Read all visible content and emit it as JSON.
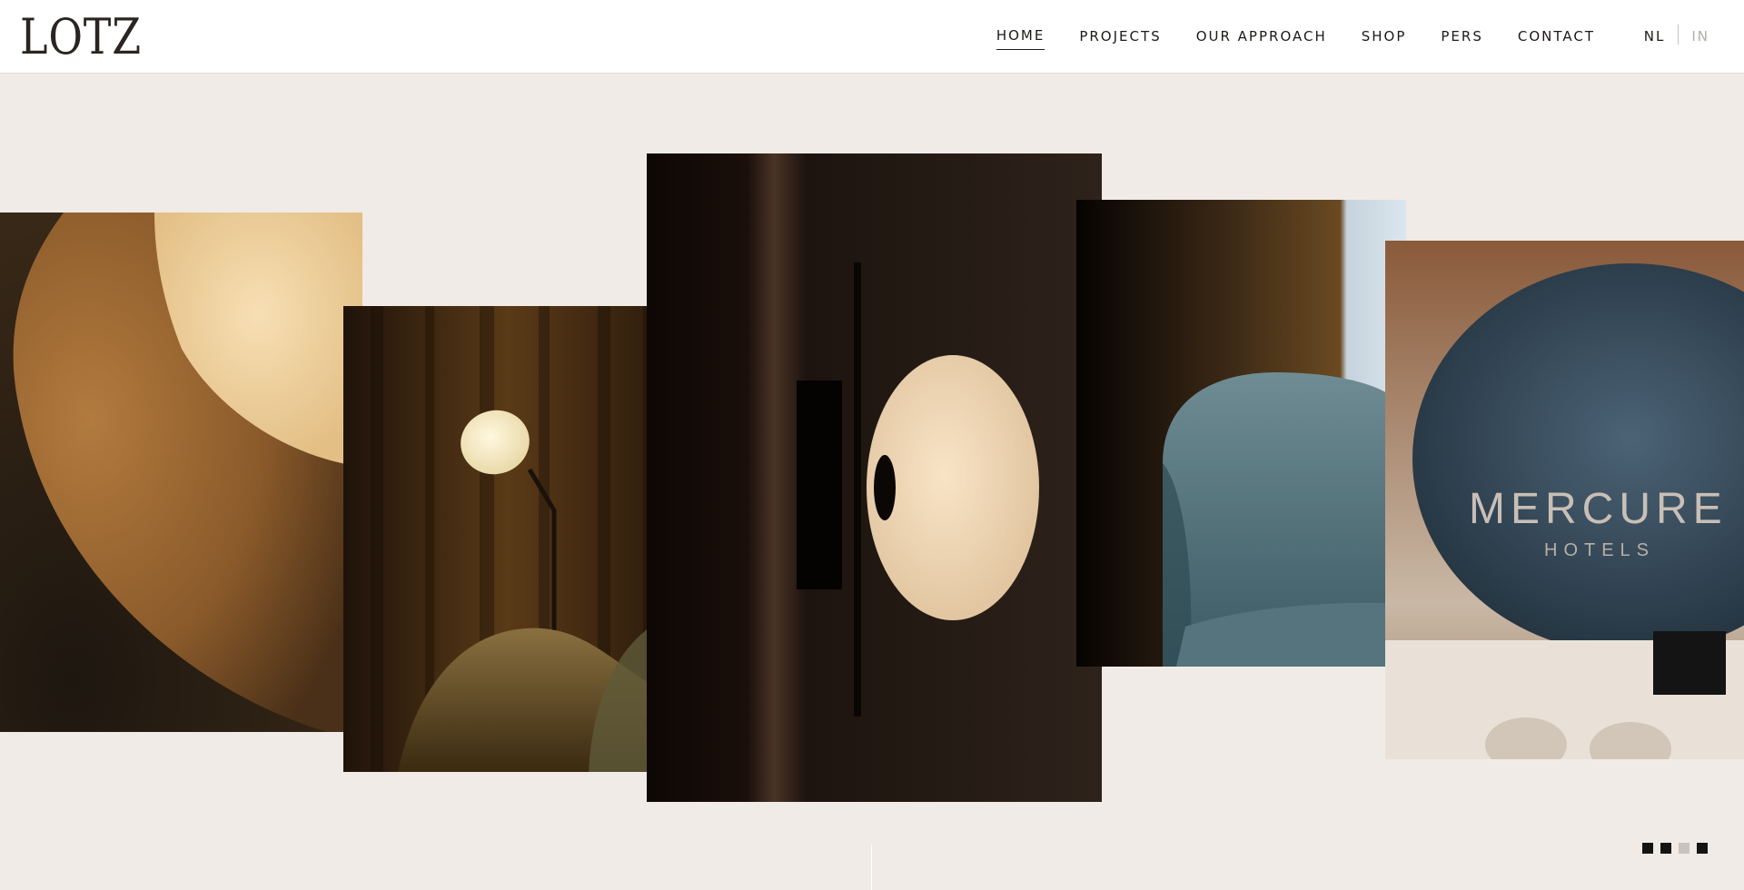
{
  "brand": {
    "logo_text": "LOTZ"
  },
  "nav": {
    "items": [
      {
        "label": "HOME",
        "active": true
      },
      {
        "label": "PROJECTS",
        "active": false
      },
      {
        "label": "OUR APPROACH",
        "active": false
      },
      {
        "label": "SHOP",
        "active": false
      },
      {
        "label": "PERS",
        "active": false
      },
      {
        "label": "CONTACT",
        "active": false
      }
    ]
  },
  "languages": {
    "current": "NL",
    "other": "IN"
  },
  "gallery": {
    "mercure_sign": {
      "title": "MERCURE",
      "subtitle": "HOTELS"
    }
  },
  "slider": {
    "dots": [
      {
        "active": true
      },
      {
        "active": true
      },
      {
        "active": false
      },
      {
        "active": true
      }
    ]
  }
}
